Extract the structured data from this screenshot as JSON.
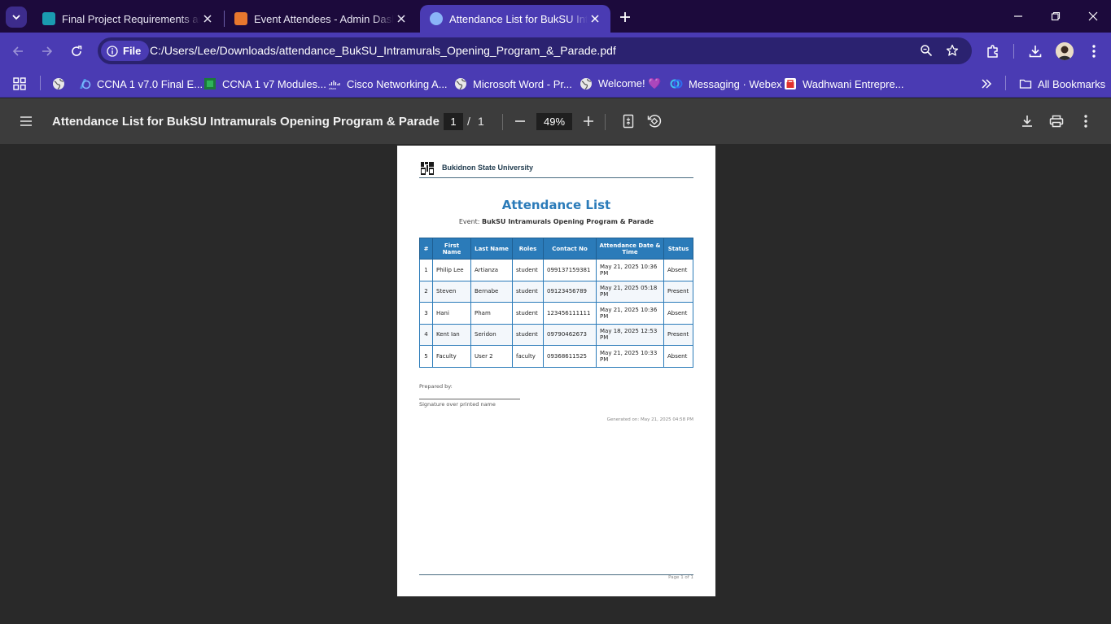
{
  "tabs": [
    {
      "title": "Final Project Requirements and",
      "favicon_color": "#1a9bb0"
    },
    {
      "title": "Event Attendees - Admin Dashb",
      "favicon_color": "#e8772e"
    },
    {
      "title": "Attendance List for BukSU Intra",
      "favicon_color": "#8ab4f8"
    }
  ],
  "toolbar": {
    "chip_label": "File",
    "url": "C:/Users/Lee/Downloads/attendance_BukSU_Intramurals_Opening_Program_&_Parade.pdf"
  },
  "bookmarks": {
    "items": [
      {
        "label": "CCNA 1 v7.0 Final E...",
        "icon": "ccna-icon"
      },
      {
        "label": "CCNA 1 v7 Modules...",
        "icon": "ccna-modules-icon"
      },
      {
        "label": "Cisco Networking A...",
        "icon": "cisco-icon"
      },
      {
        "label": "Microsoft Word - Pr...",
        "icon": "globe-icon"
      },
      {
        "label": "Welcome! 💜",
        "icon": "globe-icon"
      },
      {
        "label": "Messaging · Webex",
        "icon": "webex-icon"
      },
      {
        "label": "Wadhwani Entrepre...",
        "icon": "wadhwani-icon"
      }
    ],
    "all_label": "All Bookmarks"
  },
  "pdf": {
    "title": "Attendance List for BukSU Intramurals Opening Program & Parade",
    "page_current": "1",
    "page_total": "1",
    "zoom": "49%"
  },
  "doc": {
    "university": "Bukidnon State University",
    "title": "Attendance List",
    "event_prefix": "Event:",
    "event_name": "BukSU Intramurals Opening Program & Parade",
    "columns": [
      "#",
      "First Name",
      "Last Name",
      "Roles",
      "Contact No",
      "Attendance Date & Time",
      "Status"
    ],
    "rows": [
      [
        "1",
        "Philip Lee",
        "Artianza",
        "student",
        "099137159381",
        "May 21, 2025 10:36 PM",
        "Absent"
      ],
      [
        "2",
        "Steven",
        "Bernabe",
        "student",
        "09123456789",
        "May 21, 2025 05:18 PM",
        "Present"
      ],
      [
        "3",
        "Hani",
        "Pham",
        "student",
        "123456111111",
        "May 21, 2025 10:36 PM",
        "Absent"
      ],
      [
        "4",
        "Kent Ian",
        "Seridon",
        "student",
        "09790462673",
        "May 18, 2025 12:53 PM",
        "Present"
      ],
      [
        "5",
        "Faculty",
        "User 2",
        "faculty",
        "09368611525",
        "May 21, 2025 10:33 PM",
        "Absent"
      ]
    ],
    "prepared_by": "Prepared by:",
    "signature_label": "Signature over printed name",
    "generated": "Generated on: May 21, 2025 04:58 PM",
    "page_label": "Page 1 of 1"
  },
  "colors": {
    "tabstrip": "#1c0a3c",
    "toolbar": "#4a3bb3",
    "pdf_bar": "#3c3c3c",
    "accent_blue": "#2b7bb9"
  }
}
